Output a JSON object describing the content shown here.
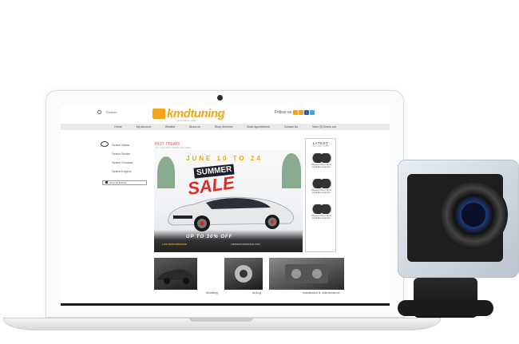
{
  "site": {
    "search_label": "Search",
    "logo_text": "kmdtuning",
    "logo_sub": "performance parts",
    "follow_label": "Follow us",
    "social": [
      "twitter",
      "rss",
      "facebook",
      "twitter-2"
    ],
    "nav": [
      "Home",
      "My Account",
      "Wishlist",
      "About us",
      "Shop Services",
      "Book Appointment",
      "Contact Us",
      "View (0) Check out"
    ]
  },
  "sidebar": {
    "items": [
      "Select Make",
      "Select Model",
      "Select Chassis",
      "Select Engine"
    ],
    "shop_button": "Shop All Brands"
  },
  "main": {
    "hot_title": "HOT ITEMS",
    "hot_subtitle": "GET YOUR BEST DEALS THIS WEEK",
    "banner": {
      "date": "JUNE 10 TO 24",
      "summer": "SUMMER",
      "sale": "SALE",
      "discount": "UP TO 30% OFF",
      "brand": "LIVE PERFORMANCE",
      "url": "LTDPERFORMANCE.COM"
    }
  },
  "latest": {
    "title": "LATEST",
    "subtitle": "OUR NEW ITEMS",
    "products": [
      {
        "name": "Stoptech Rear Sport Kit Brake Upgrade"
      },
      {
        "name": "Stoptech Rear Sport Kit Brake Upgrade"
      },
      {
        "name": "Stoptech Rear Sport Kit Brake Upgrade"
      }
    ]
  },
  "services": [
    {
      "label": "detailing"
    },
    {
      "label": "tuning"
    },
    {
      "label": "installation & maintenance"
    }
  ],
  "colors": {
    "brand": "#f2a516",
    "hot": "#e53b2c",
    "sale": "#e32b26"
  }
}
